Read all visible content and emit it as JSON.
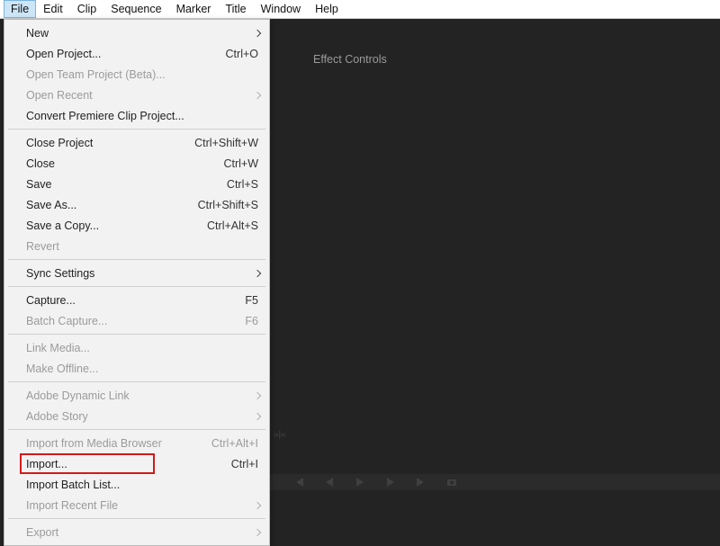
{
  "menubar": {
    "items": [
      {
        "label": "File",
        "active": true
      },
      {
        "label": "Edit"
      },
      {
        "label": "Clip"
      },
      {
        "label": "Sequence"
      },
      {
        "label": "Marker"
      },
      {
        "label": "Title"
      },
      {
        "label": "Window"
      },
      {
        "label": "Help"
      }
    ]
  },
  "file_menu": {
    "groups": [
      [
        {
          "label": "New",
          "submenu": true,
          "disabled": false
        },
        {
          "label": "Open Project...",
          "shortcut": "Ctrl+O"
        },
        {
          "label": "Open Team Project (Beta)...",
          "disabled": true
        },
        {
          "label": "Open Recent",
          "submenu": true,
          "disabled": true
        },
        {
          "label": "Convert Premiere Clip Project...",
          "disabled": false
        }
      ],
      [
        {
          "label": "Close Project",
          "shortcut": "Ctrl+Shift+W"
        },
        {
          "label": "Close",
          "shortcut": "Ctrl+W"
        },
        {
          "label": "Save",
          "shortcut": "Ctrl+S"
        },
        {
          "label": "Save As...",
          "shortcut": "Ctrl+Shift+S"
        },
        {
          "label": "Save a Copy...",
          "shortcut": "Ctrl+Alt+S"
        },
        {
          "label": "Revert",
          "disabled": true
        }
      ],
      [
        {
          "label": "Sync Settings",
          "submenu": true
        }
      ],
      [
        {
          "label": "Capture...",
          "shortcut": "F5"
        },
        {
          "label": "Batch Capture...",
          "shortcut": "F6",
          "disabled": true
        }
      ],
      [
        {
          "label": "Link Media...",
          "disabled": true
        },
        {
          "label": "Make Offline...",
          "disabled": true
        }
      ],
      [
        {
          "label": "Adobe Dynamic Link",
          "submenu": true,
          "disabled": true
        },
        {
          "label": "Adobe Story",
          "submenu": true,
          "disabled": true
        }
      ],
      [
        {
          "label": "Import from Media Browser",
          "shortcut": "Ctrl+Alt+I",
          "disabled": true
        },
        {
          "label": "Import...",
          "shortcut": "Ctrl+I",
          "highlight": true
        },
        {
          "label": "Import Batch List...",
          "disabled": false
        },
        {
          "label": "Import Recent File",
          "submenu": true,
          "disabled": true
        }
      ],
      [
        {
          "label": "Export",
          "submenu": true,
          "disabled": true
        }
      ]
    ]
  },
  "panel": {
    "tab": "Effect Controls"
  },
  "colors": {
    "highlight": "#d21a1a",
    "menubar_active_bg": "#cde6f7",
    "dark_bg": "#232323"
  }
}
